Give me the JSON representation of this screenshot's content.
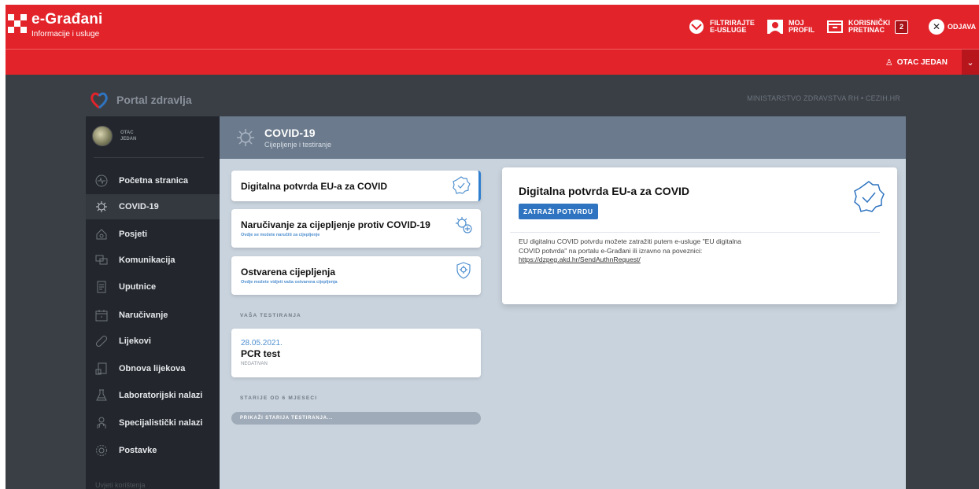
{
  "header": {
    "brand_title": "e-Građani",
    "brand_subtitle": "Informacije i usluge",
    "filter_label_1": "FILTRIRAJTE",
    "filter_label_2": "E-USLUGE",
    "profile_label_1": "MOJ",
    "profile_label_2": "PROFIL",
    "inbox_label_1": "KORISNIČKI",
    "inbox_label_2": "PRETINAC",
    "inbox_count": "2",
    "logout_label": "ODJAVA",
    "user_name": "OTAC JEDAN"
  },
  "portal": {
    "title": "Portal zdravlja",
    "ministry": "MINISTARSTVO ZDRAVSTVA RH • CEZIH.HR"
  },
  "sidebar": {
    "user_line1": "OTAC",
    "user_line2": "JEDAN",
    "items": [
      {
        "label": "Početna stranica",
        "icon": "pulse-icon"
      },
      {
        "label": "COVID-19",
        "icon": "virus-icon"
      },
      {
        "label": "Posjeti",
        "icon": "house-icon"
      },
      {
        "label": "Komunikacija",
        "icon": "chat-icon"
      },
      {
        "label": "Uputnice",
        "icon": "document-icon"
      },
      {
        "label": "Naručivanje",
        "icon": "calendar-icon"
      },
      {
        "label": "Lijekovi",
        "icon": "pill-icon"
      },
      {
        "label": "Obnova lijekova",
        "icon": "prescription-icon"
      },
      {
        "label": "Laboratorijski nalazi",
        "icon": "flask-icon"
      },
      {
        "label": "Specijalistički nalazi",
        "icon": "doctor-icon"
      },
      {
        "label": "Postavke",
        "icon": "gear-icon"
      }
    ],
    "footer": "Uvjeti korištenja"
  },
  "main": {
    "title": "COVID-19",
    "subtitle": "Cijepljenje i testiranje",
    "cards": [
      {
        "title": "Digitalna potvrda EU-a za COVID",
        "subtitle": ""
      },
      {
        "title": "Naručivanje za cijepljenje protiv COVID-19",
        "subtitle": "Ovdje se možete naručiti za cijepljenje"
      },
      {
        "title": "Ostvarena cijepljenja",
        "subtitle": "Ovdje možete vidjeti vaša ostvarena cijepljenja"
      }
    ],
    "tests_label": "VAŠA TESTIRANJA",
    "test": {
      "date": "28.05.2021.",
      "name": "PCR test",
      "result": "NEGATIVAN"
    },
    "older_label": "STARIJE OD 6 MJESECI",
    "older_button": "PRIKAŽI STARIJA TESTIRANJA..."
  },
  "detail": {
    "title": "Digitalna potvrda EU-a za COVID",
    "button": "ZATRAŽI POTVRDU",
    "text": "EU digitalnu COVID potvrdu možete zatražiti putem e-usluge \"EU digitalna COVID potvrda\" na portalu e-Građani ili izravno na poveznici:",
    "link": "https://dzpeg.akd.hr/SendAuthnRequest/"
  }
}
